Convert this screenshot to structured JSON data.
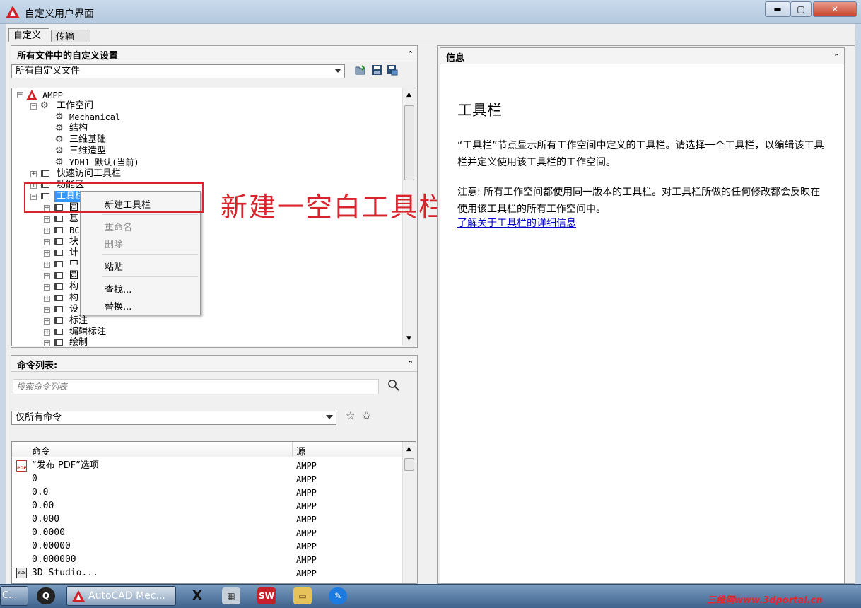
{
  "window": {
    "title": "自定义用户界面",
    "min": "▬",
    "max": "▢",
    "close": "✕"
  },
  "tabs": [
    "自定义",
    "传输"
  ],
  "left_top": {
    "header": "所有文件中的自定义设置",
    "file_combo": "所有自定义文件",
    "tree": [
      {
        "label": "AMPP",
        "mono": true
      },
      {
        "label": "工作空间"
      },
      {
        "label": "Mechanical",
        "mono": true
      },
      {
        "label": "结构"
      },
      {
        "label": "三维基础"
      },
      {
        "label": "三维造型"
      },
      {
        "label": "YDH1 默认(当前)",
        "mono": true
      },
      {
        "label": "快速访问工具栏"
      },
      {
        "label": "功能区"
      },
      {
        "label": "工具栏"
      },
      {
        "label": "圆"
      },
      {
        "label": "基"
      },
      {
        "label": "BC",
        "mono": true
      },
      {
        "label": "块"
      },
      {
        "label": "计"
      },
      {
        "label": "中"
      },
      {
        "label": "圆"
      },
      {
        "label": "构"
      },
      {
        "label": "构"
      },
      {
        "label": "设"
      },
      {
        "label": "标注"
      },
      {
        "label": "编辑标注"
      },
      {
        "label": "绘制"
      }
    ]
  },
  "context_menu": {
    "new_toolbar": "新建工具栏",
    "rename": "重命名",
    "delete": "删除",
    "paste": "粘贴",
    "find": "查找...",
    "replace": "替换..."
  },
  "annotation": "新建一空白工具栏",
  "commands": {
    "header": "命令列表:",
    "search_placeholder": "搜索命令列表",
    "filter": "仅所有命令",
    "col_command": "命令",
    "col_source": "源",
    "rows": [
      {
        "name": "“发布 PDF”选项",
        "source": "AMPP"
      },
      {
        "name": "0",
        "source": "AMPP"
      },
      {
        "name": "0.0",
        "source": "AMPP"
      },
      {
        "name": "0.00",
        "source": "AMPP"
      },
      {
        "name": "0.000",
        "source": "AMPP"
      },
      {
        "name": "0.0000",
        "source": "AMPP"
      },
      {
        "name": "0.00000",
        "source": "AMPP"
      },
      {
        "name": "0.000000",
        "source": "AMPP"
      },
      {
        "name": "3D Studio...",
        "source": "AMPP"
      }
    ]
  },
  "info": {
    "header": "信息",
    "title": "工具栏",
    "desc": "“工具栏”节点显示所有工作空间中定义的工具栏。请选择一个工具栏，以编辑该工具栏并定义使用该工具栏的工作空间。",
    "note": "注意: 所有工作空间都使用同一版本的工具栏。对工具栏所做的任何修改都会反映在使用该工具栏的所有工作空间中。",
    "link": "了解关于工具栏的详细信息"
  },
  "taskbar": {
    "active": "AutoCAD Mec...",
    "watermark": "三维网www.3dportal.cn",
    "left_stub": "C..."
  }
}
